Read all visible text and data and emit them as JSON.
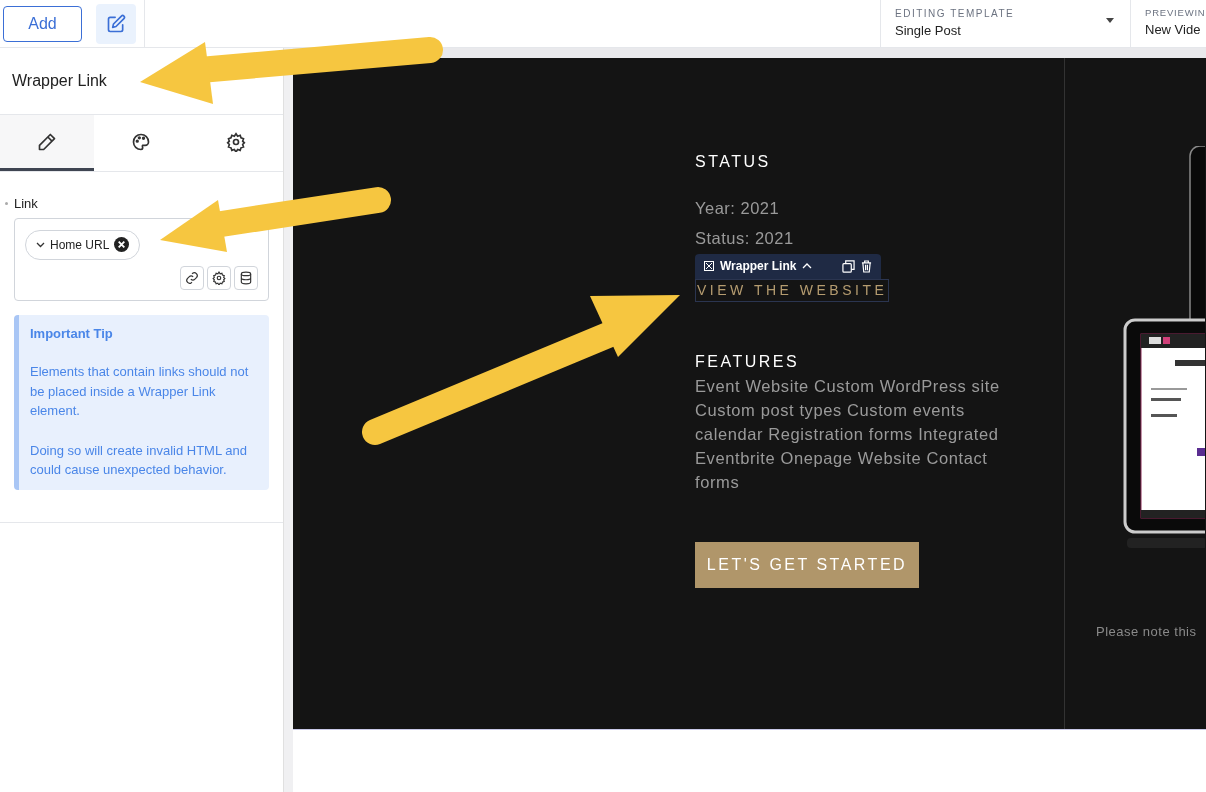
{
  "topbar": {
    "add_button": "Add",
    "template": {
      "label": "EDITING TEMPLATE",
      "value": "Single Post"
    },
    "preview": {
      "label": "PREVIEWIN",
      "value": "New Vide"
    }
  },
  "panel": {
    "title": "Wrapper Link",
    "tabs": [
      {
        "kind": "edit",
        "selected": true
      },
      {
        "kind": "style",
        "selected": false
      },
      {
        "kind": "settings",
        "selected": false
      }
    ],
    "field": {
      "label": "Link",
      "chip": "Home URL"
    },
    "tip": {
      "title": "Important Tip",
      "paragraphs": [
        "Elements that contain links should not be placed inside a Wrapper Link element.",
        "Doing so will create invalid HTML and could cause unexpected behavior."
      ]
    }
  },
  "canvas": {
    "status_heading": "STATUS",
    "status_lines": [
      "Year: 2021",
      "Status: 2021"
    ],
    "toolbar_label": "Wrapper Link",
    "link": "VIEW THE WEBSITE",
    "features_heading": "FEATURES",
    "features_text": "Event Website Custom WordPress site Custom post types Custom events calendar Registration forms Integrated Eventbrite Onepage Website Contact forms",
    "cta_button": "LET'S GET STARTED",
    "note": "Please note this"
  }
}
